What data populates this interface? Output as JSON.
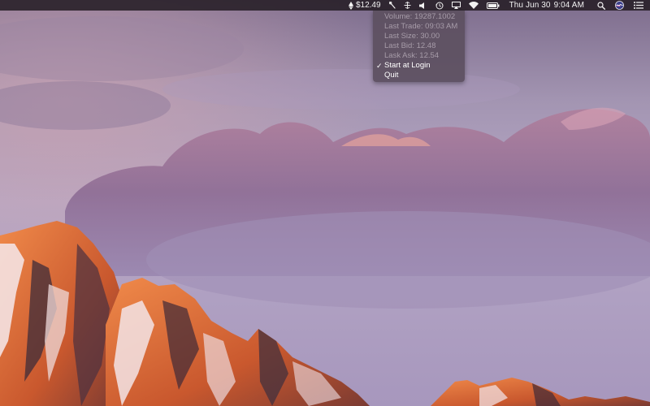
{
  "menubar": {
    "ticker_price": "$12.49",
    "clock_day_date": "Thu Jun 30",
    "clock_time": "9:04 AM",
    "icons": [
      "ethereum-icon",
      "tool-icon",
      "network-icon",
      "volume-icon",
      "time-machine-icon",
      "airplay-icon",
      "wifi-icon",
      "battery-icon",
      "search-icon",
      "siri-icon",
      "notification-center-icon"
    ]
  },
  "dropdown": {
    "items": [
      {
        "label": "Volume: 19287.1002",
        "enabled": false,
        "checked": false
      },
      {
        "label": "Last Trade: 09:03 AM",
        "enabled": false,
        "checked": false
      },
      {
        "label": "Last Size: 30.00",
        "enabled": false,
        "checked": false
      },
      {
        "label": "Last Bid: 12.48",
        "enabled": false,
        "checked": false
      },
      {
        "label": "Lask Ask: 12.54",
        "enabled": false,
        "checked": false
      },
      {
        "label": "Start at Login",
        "enabled": true,
        "checked": true
      },
      {
        "label": "Quit",
        "enabled": true,
        "checked": false
      }
    ],
    "check_glyph": "✓"
  },
  "colors": {
    "menubar_bg": "#261e26",
    "menu_bg": "#5c5060",
    "menu_disabled_text": "#a79ca9",
    "menu_enabled_text": "#ffffff",
    "sky_top": "#8a7a98",
    "sky_bottom": "#b9a9c8",
    "mountain_lit": "#e0703a",
    "mountain_shadow": "#4a3040",
    "snow": "#f2e6e8"
  }
}
